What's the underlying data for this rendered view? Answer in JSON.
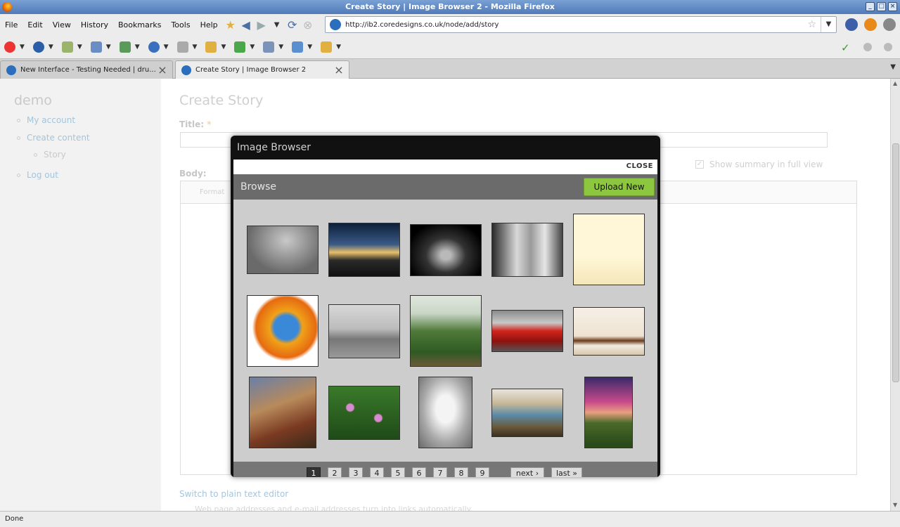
{
  "window": {
    "title": "Create Story | Image Browser 2 - Mozilla Firefox",
    "buttons": [
      "_",
      "□",
      "×"
    ]
  },
  "menu": {
    "items": [
      "File",
      "Edit",
      "View",
      "History",
      "Bookmarks",
      "Tools",
      "Help"
    ]
  },
  "nav": {
    "url": "http://ib2.coredesigns.co.uk/node/add/story",
    "icons": [
      "bookmark-star-icon",
      "back-arrow-icon",
      "forward-arrow-icon",
      "history-dropdown-icon",
      "reload-icon",
      "stop-icon"
    ]
  },
  "tabs": [
    {
      "label": "New Interface - Testing Needed | dru...",
      "active": false
    },
    {
      "label": "Create Story | Image Browser 2",
      "active": true
    }
  ],
  "sidebar": {
    "site_name": "demo",
    "links": [
      {
        "label": "My account"
      },
      {
        "label": "Create content"
      },
      {
        "label": "Story"
      },
      {
        "label": "Log out"
      }
    ]
  },
  "form": {
    "page_title": "Create Story",
    "title_label": "Title:",
    "required_mark": "*",
    "summary_label": "Show summary in full view",
    "summary_check": "✓",
    "body_label": "Body:",
    "format_label": "Format",
    "plain_text_link": "Switch to plain text editor",
    "plain_text_hint": "Web page addresses and e-mail addresses turn into links automatically."
  },
  "modal": {
    "title": "Image Browser",
    "close_label": "CLOSE",
    "browse_label": "Browse",
    "upload_label": "Upload New",
    "images": [
      {
        "name": "yoga-pose"
      },
      {
        "name": "sunset"
      },
      {
        "name": "concept-car"
      },
      {
        "name": "two-women"
      },
      {
        "name": "cyrillic-banner"
      },
      {
        "name": "firefox-logo"
      },
      {
        "name": "utility-vehicle"
      },
      {
        "name": "garden"
      },
      {
        "name": "red-sports-car"
      },
      {
        "name": "bathroom"
      },
      {
        "name": "iron-maiden-art"
      },
      {
        "name": "water-lilies"
      },
      {
        "name": "white-cat"
      },
      {
        "name": "cabana"
      },
      {
        "name": "phone-sunset-wallpaper"
      }
    ],
    "pager": {
      "pages": [
        "1",
        "2",
        "3",
        "4",
        "5",
        "6",
        "7",
        "8",
        "9"
      ],
      "current": "1",
      "next": "next ›",
      "last": "last »"
    }
  },
  "status": {
    "text": "Done"
  },
  "colors": {
    "upload_green": "#8dc63f",
    "titlebar_blue": "#4f7ab8",
    "link_blue": "#a5c4da"
  }
}
